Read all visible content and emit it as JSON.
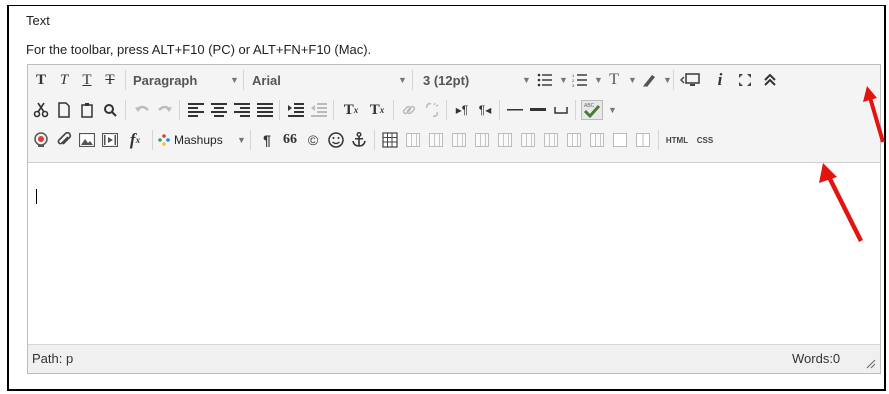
{
  "field_label": "Text",
  "instructions": "For the toolbar, press ALT+F10 (PC) or ALT+FN+F10 (Mac).",
  "toolbar": {
    "row1": {
      "bold": "T",
      "italic": "T",
      "underline": "T",
      "strikethrough": "T",
      "paragraph_select": "Paragraph",
      "font_select": "Arial",
      "size_select": "3 (12pt)",
      "text_color": "T"
    },
    "row2": {
      "superscript": "T",
      "superscript_mark": "x",
      "subscript": "T",
      "subscript_mark": "x"
    },
    "row3": {
      "math": "f",
      "math_mark": "x",
      "mashups": "Mashups",
      "paragraph_mark": "¶",
      "blockquote": "66",
      "copyright": "©",
      "html_button": "HTML",
      "css_button": "CSS"
    }
  },
  "status_bar": {
    "path": "Path: p",
    "words": "Words:0"
  },
  "colors": {
    "annotation_arrow": "#e3130f",
    "toolbar_bg": "#f4f4f4",
    "mashups_dots": [
      "#e53935",
      "#43a047",
      "#1e88e5",
      "#fbc02d"
    ]
  }
}
